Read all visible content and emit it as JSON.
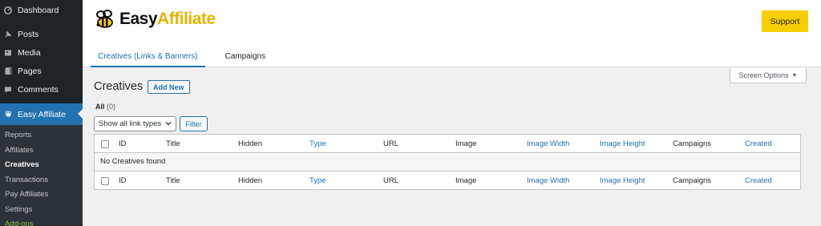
{
  "sidebar": {
    "top_items": [
      {
        "label": "Dashboard",
        "icon": "dashboard-icon"
      },
      {
        "label": "Posts",
        "icon": "pin-icon"
      },
      {
        "label": "Media",
        "icon": "media-icon"
      },
      {
        "label": "Pages",
        "icon": "pages-icon"
      },
      {
        "label": "Comments",
        "icon": "comments-icon"
      }
    ],
    "active_item": {
      "label": "Easy Affiliate",
      "icon": "bee-icon"
    },
    "sub_items": [
      {
        "label": "Reports"
      },
      {
        "label": "Affiliates"
      },
      {
        "label": "Creatives"
      },
      {
        "label": "Transactions"
      },
      {
        "label": "Pay Affiliates"
      },
      {
        "label": "Settings"
      },
      {
        "label": "Add-ons"
      }
    ]
  },
  "header": {
    "logo_word_1": "Easy",
    "logo_word_2": "Affiliate",
    "support_label": "Support",
    "tabs": [
      {
        "label": "Creatives (Links & Banners)"
      },
      {
        "label": "Campaigns"
      }
    ]
  },
  "main": {
    "screen_options_label": "Screen Options",
    "title": "Creatives",
    "add_new_label": "Add New",
    "filter_all_label": "All",
    "filter_all_count": "(0)",
    "link_type_select": "Show all link types",
    "filter_button_label": "Filter",
    "columns": [
      "ID",
      "Title",
      "Hidden",
      "Type",
      "URL",
      "Image",
      "Image Width",
      "Image Height",
      "Campaigns",
      "Created"
    ],
    "empty_message": "No Creatives found"
  },
  "colors": {
    "sidebar_bg": "#1d2327",
    "accent_blue": "#2271b1",
    "support_yellow": "#f7ce00",
    "logo_yellow": "#e8b400",
    "addons_green": "#8bc34a"
  }
}
